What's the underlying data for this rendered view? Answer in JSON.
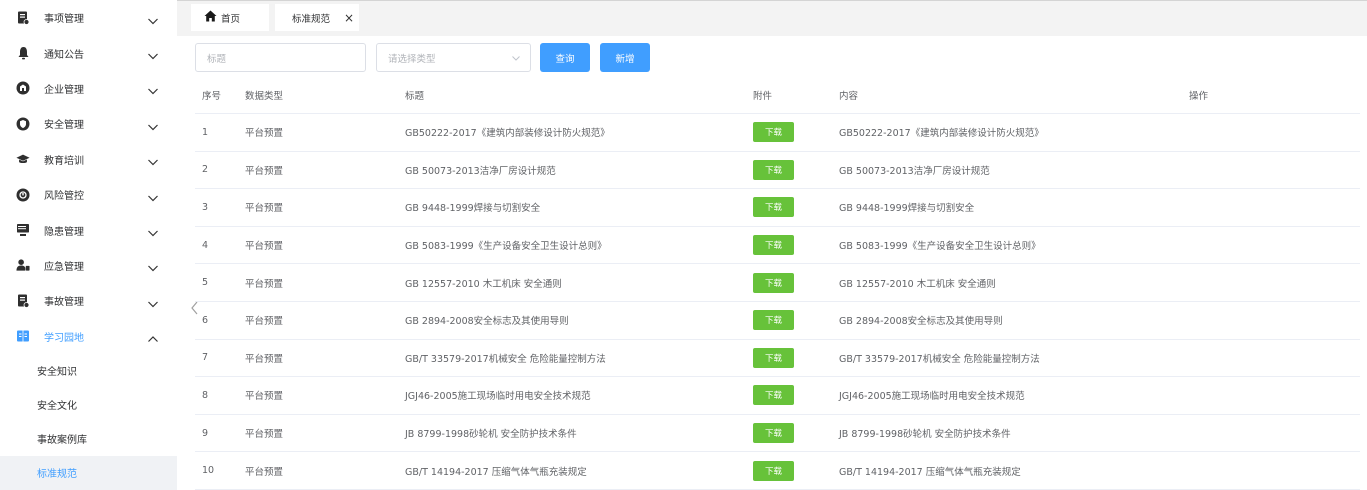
{
  "sidebar": {
    "items": [
      {
        "label": "事项管理",
        "icon": "document-check-icon",
        "open": false
      },
      {
        "label": "通知公告",
        "icon": "bell-icon",
        "open": false
      },
      {
        "label": "企业管理",
        "icon": "building-badge-icon",
        "open": false
      },
      {
        "label": "安全管理",
        "icon": "shield-icon",
        "open": false
      },
      {
        "label": "教育培训",
        "icon": "graduation-cap-icon",
        "open": false
      },
      {
        "label": "风险管控",
        "icon": "risk-badge-icon",
        "open": false
      },
      {
        "label": "隐患管理",
        "icon": "monitor-icon",
        "open": false
      },
      {
        "label": "应急管理",
        "icon": "user-emergency-icon",
        "open": false
      },
      {
        "label": "事故管理",
        "icon": "document-check-icon",
        "open": false
      },
      {
        "label": "学习园地",
        "icon": "book-icon",
        "open": true
      }
    ],
    "sub_items": [
      "安全知识",
      "安全文化",
      "事故案例库",
      "标准规范"
    ],
    "active_sub": "标准规范"
  },
  "tabs": {
    "home": "首页",
    "current": "标准规范",
    "close": "×"
  },
  "filter": {
    "title_placeholder": "标题",
    "type_placeholder": "请选择类型",
    "query_label": "查询",
    "add_label": "新增"
  },
  "table": {
    "headers": {
      "no": "序号",
      "type": "数据类型",
      "title": "标题",
      "attachment": "附件",
      "content": "内容",
      "operation": "操作"
    },
    "download_label": "下载",
    "rows": [
      {
        "no": "1",
        "type": "平台预置",
        "title": "GB50222-2017《建筑内部装修设计防火规范》",
        "content": "GB50222-2017《建筑内部装修设计防火规范》"
      },
      {
        "no": "2",
        "type": "平台预置",
        "title": "GB 50073-2013洁净厂房设计规范",
        "content": "GB 50073-2013洁净厂房设计规范"
      },
      {
        "no": "3",
        "type": "平台预置",
        "title": "GB 9448-1999焊接与切割安全",
        "content": "GB 9448-1999焊接与切割安全"
      },
      {
        "no": "4",
        "type": "平台预置",
        "title": "GB 5083-1999《生产设备安全卫生设计总则》",
        "content": "GB 5083-1999《生产设备安全卫生设计总则》"
      },
      {
        "no": "5",
        "type": "平台预置",
        "title": "GB 12557-2010 木工机床 安全通则",
        "content": "GB 12557-2010 木工机床 安全通则"
      },
      {
        "no": "6",
        "type": "平台预置",
        "title": "GB 2894-2008安全标志及其使用导则",
        "content": "GB 2894-2008安全标志及其使用导则"
      },
      {
        "no": "7",
        "type": "平台预置",
        "title": "GB/T 33579-2017机械安全 危险能量控制方法",
        "content": "GB/T 33579-2017机械安全 危险能量控制方法"
      },
      {
        "no": "8",
        "type": "平台预置",
        "title": "JGJ46-2005施工现场临时用电安全技术规范",
        "content": "JGJ46-2005施工现场临时用电安全技术规范"
      },
      {
        "no": "9",
        "type": "平台预置",
        "title": "JB 8799-1998砂轮机 安全防护技术条件",
        "content": "JB 8799-1998砂轮机 安全防护技术条件"
      },
      {
        "no": "10",
        "type": "平台预置",
        "title": "GB/T 14194-2017 压缩气体气瓶充装规定",
        "content": "GB/T 14194-2017 压缩气体气瓶充装规定"
      }
    ]
  },
  "colors": {
    "primary": "#409eff",
    "success": "#67c23a",
    "tabbar": "#f3f3f3"
  }
}
